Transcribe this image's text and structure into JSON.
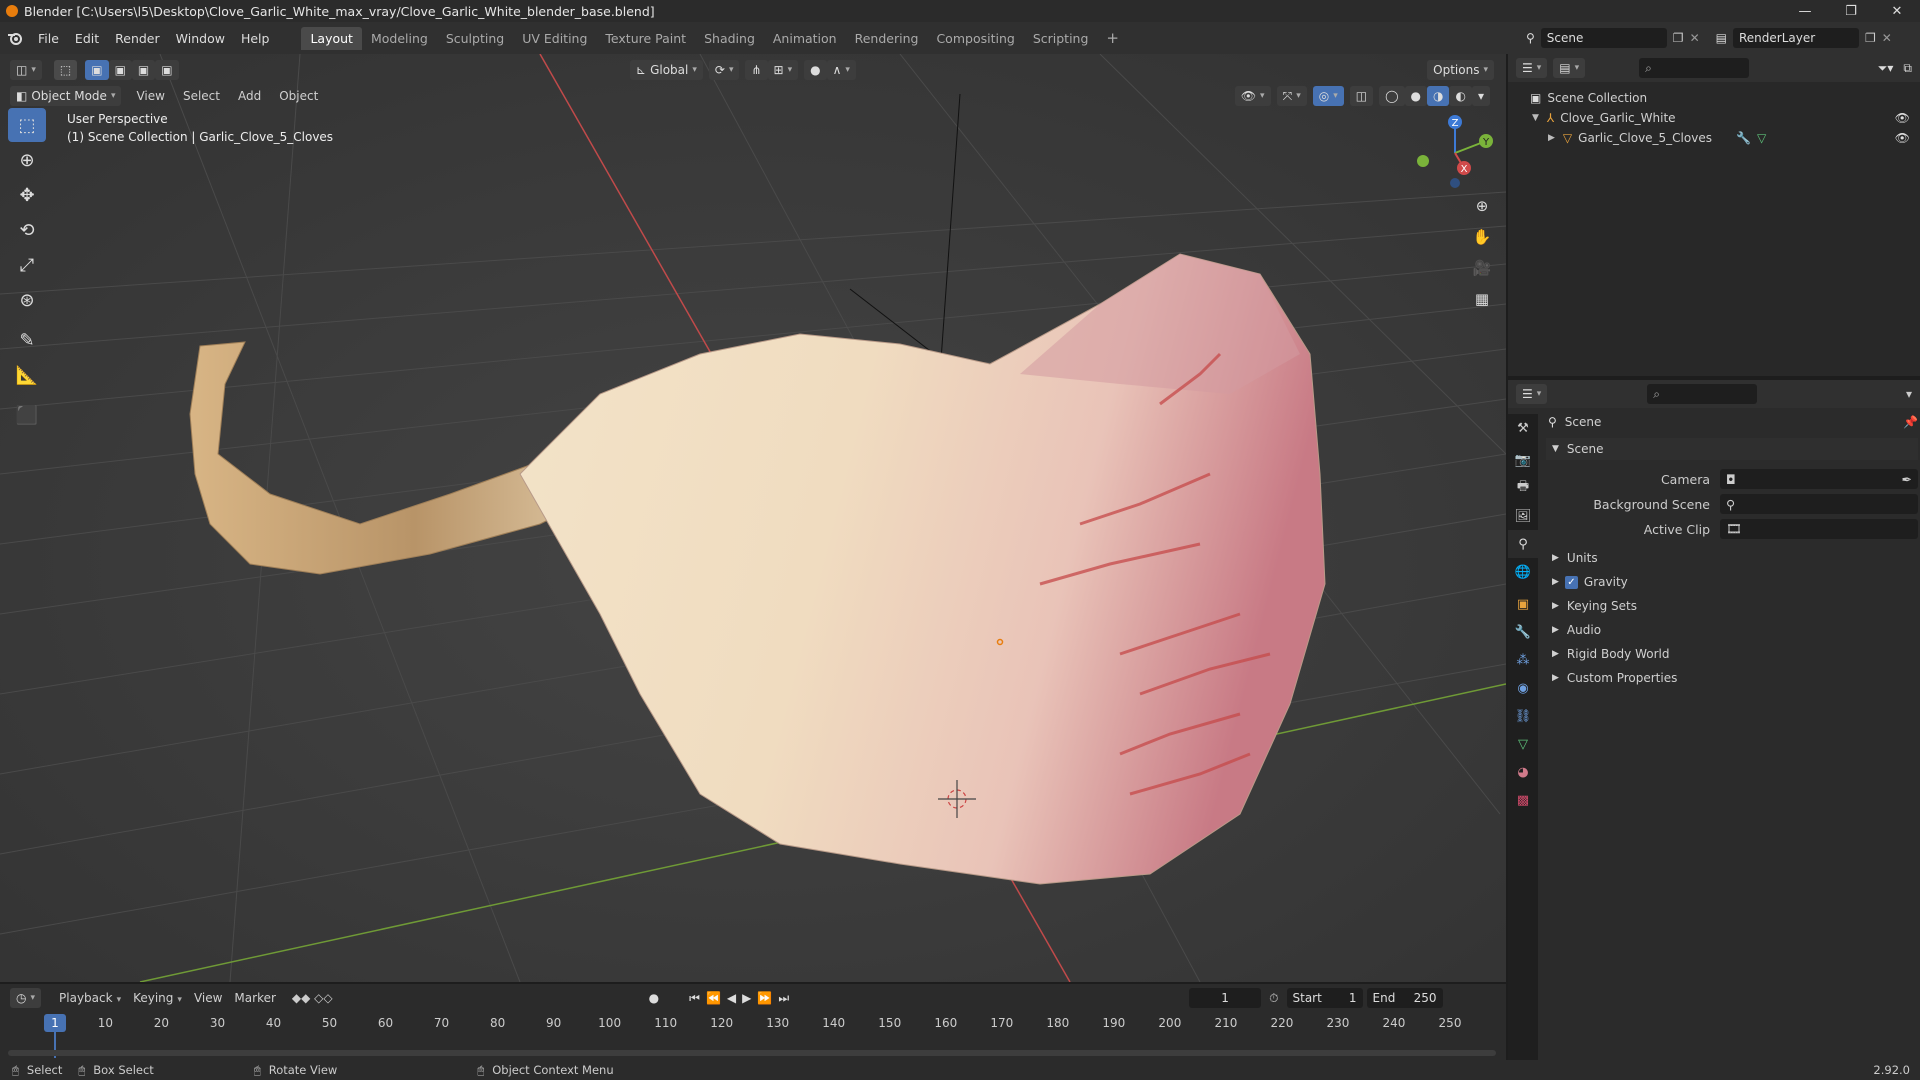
{
  "window": {
    "title": "Blender [C:\\Users\\l5\\Desktop\\Clove_Garlic_White_max_vray/Clove_Garlic_White_blender_base.blend]",
    "buttons": [
      "—",
      "❐",
      "✕"
    ]
  },
  "menu": {
    "items": [
      "File",
      "Edit",
      "Render",
      "Window",
      "Help"
    ]
  },
  "workspaces": {
    "active": "Layout",
    "tabs": [
      "Layout",
      "Modeling",
      "Sculpting",
      "UV Editing",
      "Texture Paint",
      "Shading",
      "Animation",
      "Rendering",
      "Compositing",
      "Scripting"
    ],
    "add": "+"
  },
  "scene_selector": {
    "value": "Scene"
  },
  "renderlayer_selector": {
    "value": "RenderLayer"
  },
  "viewport": {
    "transform_orientation": "Global",
    "options_label": "Options",
    "mode": "Object Mode",
    "menus": [
      "View",
      "Select",
      "Add",
      "Object"
    ],
    "overlay_line1": "User Perspective",
    "overlay_line2": "(1) Scene Collection | Garlic_Clove_5_Cloves",
    "gizmo": {
      "x": "X",
      "y": "Y",
      "z": "Z"
    }
  },
  "outliner": {
    "root": "Scene Collection",
    "items": [
      {
        "label": "Clove_Garlic_White"
      },
      {
        "label": "Garlic_Clove_5_Cloves"
      }
    ]
  },
  "properties": {
    "header": "Scene",
    "panel_title": "Scene",
    "camera_label": "Camera",
    "background_label": "Background Scene",
    "clip_label": "Active Clip",
    "sections": [
      "Units",
      "Gravity",
      "Keying Sets",
      "Audio",
      "Rigid Body World",
      "Custom Properties"
    ],
    "gravity_checked": true
  },
  "timeline": {
    "menus": [
      "Playback",
      "Keying",
      "View",
      "Marker"
    ],
    "current_frame": "1",
    "start_label": "Start",
    "start_value": "1",
    "end_label": "End",
    "end_value": "250",
    "ticks": [
      "1",
      "10",
      "20",
      "30",
      "40",
      "50",
      "60",
      "70",
      "80",
      "90",
      "100",
      "110",
      "120",
      "130",
      "140",
      "150",
      "160",
      "170",
      "180",
      "190",
      "200",
      "210",
      "220",
      "230",
      "240",
      "250"
    ]
  },
  "status": {
    "select": "Select",
    "box_select": "Box Select",
    "rotate": "Rotate View",
    "context": "Object Context Menu",
    "version": "2.92.0"
  },
  "colors": {
    "accent": "#4772b3",
    "x_axis": "#d04a4a",
    "y_axis": "#7ab33a",
    "z_axis": "#3d7ad6",
    "origin": "#e87d0d"
  }
}
